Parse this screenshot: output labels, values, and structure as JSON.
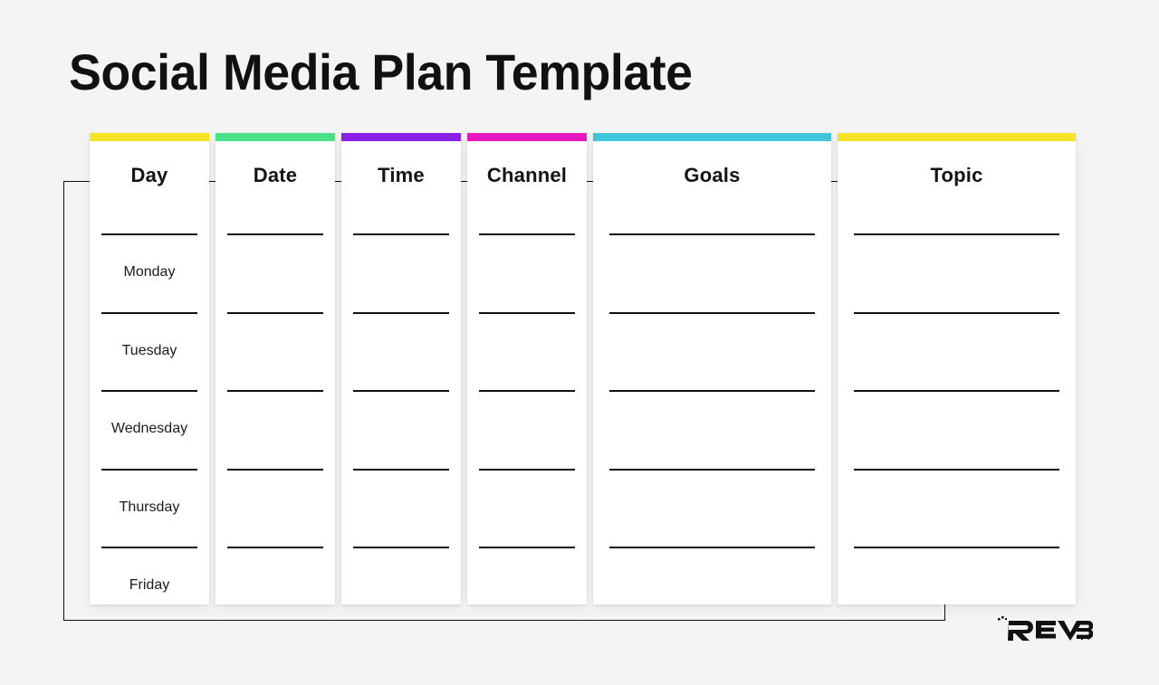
{
  "page": {
    "title": "Social Media Plan Template",
    "background_color": "#f4f4f4"
  },
  "logo": {
    "name": "reverb-logo",
    "text": "REVERB"
  },
  "table": {
    "columns": [
      {
        "key": "day",
        "label": "Day",
        "accent_color": "#f5e425",
        "width": "narrow"
      },
      {
        "key": "date",
        "label": "Date",
        "accent_color": "#4ce08d",
        "width": "narrow"
      },
      {
        "key": "time",
        "label": "Time",
        "accent_color": "#8a20e8",
        "width": "narrow"
      },
      {
        "key": "channel",
        "label": "Channel",
        "accent_color": "#e818c0",
        "width": "narrow"
      },
      {
        "key": "goals",
        "label": "Goals",
        "accent_color": "#3ec6da",
        "width": "wide"
      },
      {
        "key": "topic",
        "label": "Topic",
        "accent_color": "#f5e425",
        "width": "wide"
      }
    ],
    "rows": [
      {
        "day": "Monday",
        "date": "",
        "time": "",
        "channel": "",
        "goals": "",
        "topic": ""
      },
      {
        "day": "Tuesday",
        "date": "",
        "time": "",
        "channel": "",
        "goals": "",
        "topic": ""
      },
      {
        "day": "Wednesday",
        "date": "",
        "time": "",
        "channel": "",
        "goals": "",
        "topic": ""
      },
      {
        "day": "Thursday",
        "date": "",
        "time": "",
        "channel": "",
        "goals": "",
        "topic": ""
      },
      {
        "day": "Friday",
        "date": "",
        "time": "",
        "channel": "",
        "goals": "",
        "topic": ""
      }
    ]
  }
}
